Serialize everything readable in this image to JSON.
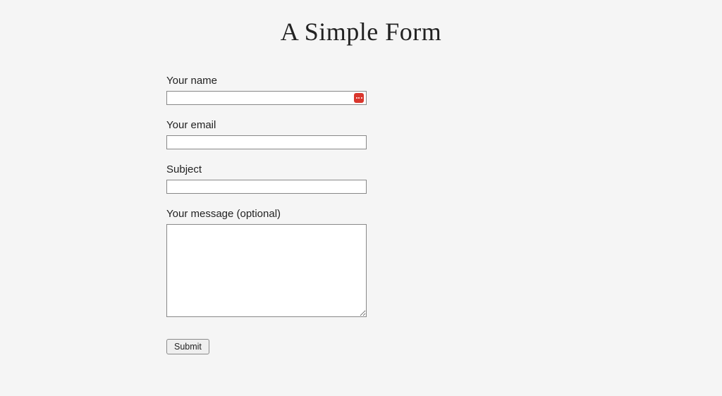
{
  "title": "A Simple Form",
  "fields": {
    "name": {
      "label": "Your name",
      "value": ""
    },
    "email": {
      "label": "Your email",
      "value": ""
    },
    "subject": {
      "label": "Subject",
      "value": ""
    },
    "message": {
      "label": "Your message (optional)",
      "value": ""
    }
  },
  "submit_label": "Submit"
}
